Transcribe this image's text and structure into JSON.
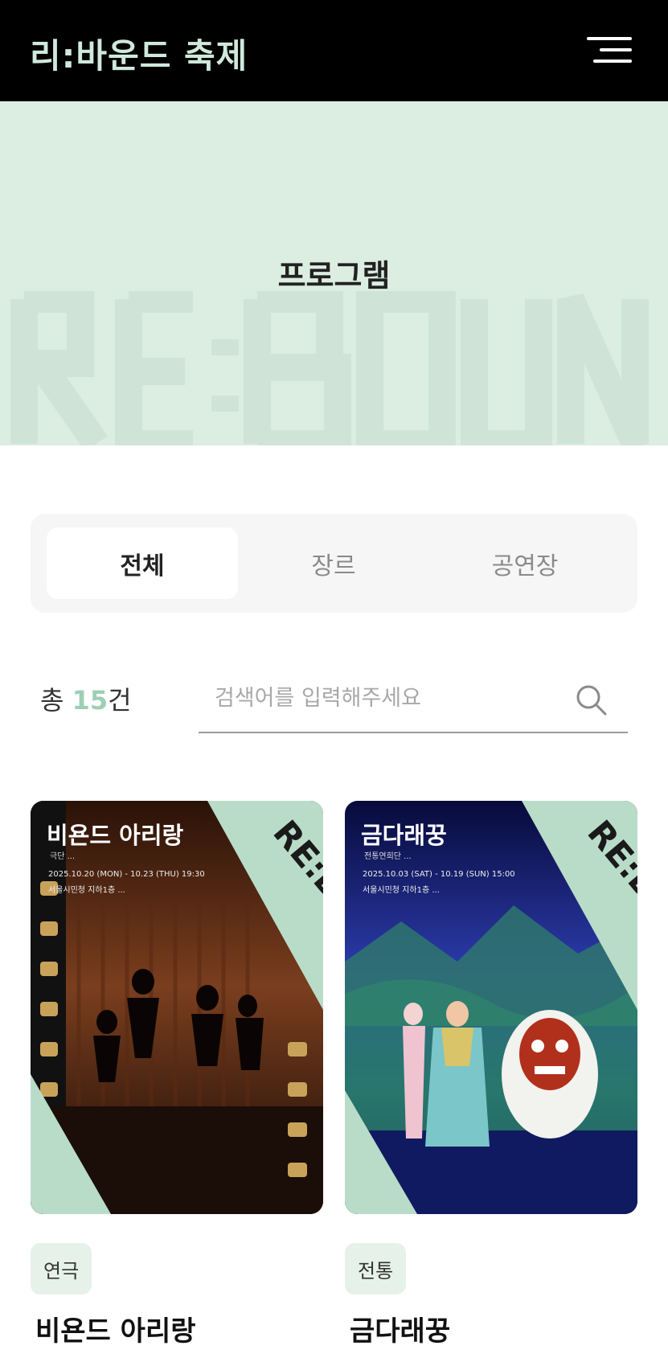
{
  "header": {
    "logo": "리:바운드 축제",
    "menu_icon": "hamburger-menu-icon"
  },
  "hero": {
    "title": "프로그램",
    "watermark": "RE:BOUND"
  },
  "tabs": [
    {
      "label": "전체",
      "active": true
    },
    {
      "label": "장르",
      "active": false
    },
    {
      "label": "공연장",
      "active": false
    }
  ],
  "count": {
    "prefix": "총 ",
    "number": "15",
    "suffix": "건"
  },
  "search": {
    "placeholder": "검색어를 입력해주세요",
    "value": "",
    "icon": "search-icon"
  },
  "programs": [
    {
      "title": "비욘드 아리랑",
      "genre": "연극",
      "poster_title": "비욘드 아리랑",
      "poster_subtitle": "극단 ...",
      "poster_date": "2025.10.20 (MON) - 10.23 (THU) 19:30",
      "poster_venue": "서울시민청 지하1층 ..."
    },
    {
      "title": "금다래꿍",
      "genre": "전통",
      "poster_title": "금다래꿍",
      "poster_subtitle": "전통연희단 ...",
      "poster_date": "2025.10.03 (SAT) - 10.19 (SUN) 15:00",
      "poster_venue": "서울시민청 지하1층 ..."
    }
  ],
  "colors": {
    "accent": "#9ccfb4",
    "hero_bg": "#dcede2",
    "header_bg": "#000000"
  }
}
